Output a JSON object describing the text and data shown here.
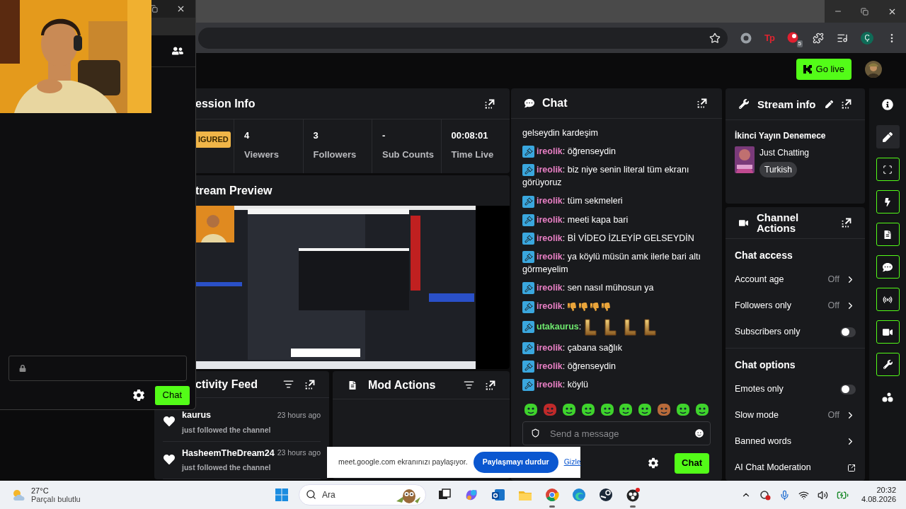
{
  "browser": {
    "window_controls": [
      {
        "kind": "minimize"
      },
      {
        "kind": "maximize"
      },
      {
        "kind": "close"
      }
    ],
    "toolbar": [
      {
        "kind": "star"
      },
      {
        "kind": "circle-extension"
      },
      {
        "kind": "text-extension",
        "label": "Tp"
      },
      {
        "kind": "badge-extension",
        "badge": "5"
      },
      {
        "kind": "puzzle"
      },
      {
        "kind": "media"
      },
      {
        "kind": "profile",
        "label": "Ç"
      },
      {
        "kind": "menu"
      }
    ]
  },
  "header": {
    "go_live": "Go live"
  },
  "session_info": {
    "title": "ession Info",
    "status": "IGURED",
    "stats": [
      {
        "value": "4",
        "label": "Viewers"
      },
      {
        "value": "3",
        "label": "Followers"
      },
      {
        "value": "-",
        "label": "Sub Counts"
      },
      {
        "value": "00:08:01",
        "label": "Time Live"
      }
    ]
  },
  "stream_preview": {
    "title": "tream Preview"
  },
  "activity_feed": {
    "title": "ctivity Feed",
    "items": [
      {
        "name": "kaurus",
        "time": "23 hours ago",
        "text": "just followed the channel"
      },
      {
        "name": "HasheemTheDream24",
        "time": "23 hours ago",
        "text": "just followed the channel"
      }
    ]
  },
  "mod_actions": {
    "title": "Mod Actions"
  },
  "chat": {
    "title": "Chat",
    "messages": [
      {
        "kind": "continuation",
        "text": "gelseydin kardeşim"
      },
      {
        "kind": "text",
        "user": "ireolik",
        "color": "#e87fc4",
        "text": ": öğrenseydin"
      },
      {
        "kind": "text",
        "user": "ireolik",
        "color": "#e87fc4",
        "text": ": biz niye senin literal tüm ekranı görüyoruz"
      },
      {
        "kind": "text",
        "user": "ireolik",
        "color": "#e87fc4",
        "text": ": tüm sekmeleri"
      },
      {
        "kind": "text",
        "user": "ireolik",
        "color": "#e87fc4",
        "text": ": meeti kapa bari"
      },
      {
        "kind": "text",
        "user": "ireolik",
        "color": "#e87fc4",
        "text": ": Bİ VİDEO İZLEYİP GELSEYDİN"
      },
      {
        "kind": "text",
        "user": "ireolik",
        "color": "#e87fc4",
        "text": ": ya köylü müsün amk ilerle bari altı görmeyelim"
      },
      {
        "kind": "text",
        "user": "ireolik",
        "color": "#e87fc4",
        "text": ": sen nasıl mühosun ya"
      },
      {
        "kind": "emotes",
        "user": "ireolik",
        "color": "#e87fc4",
        "text": ":",
        "emotes": [
          {
            "kind": "thumbs-down"
          },
          {
            "kind": "thumbs-down"
          },
          {
            "kind": "thumbs-down"
          },
          {
            "kind": "thumbs-down"
          }
        ]
      },
      {
        "kind": "emotes",
        "user": "utakaurus",
        "color": "#6ee86e",
        "text": ":",
        "emotes": [
          {
            "kind": "gold-l"
          },
          {
            "kind": "gold-l"
          },
          {
            "kind": "gold-l"
          },
          {
            "kind": "gold-l"
          }
        ]
      },
      {
        "kind": "text",
        "user": "ireolik",
        "color": "#e87fc4",
        "text": ": çabana sağlık"
      },
      {
        "kind": "text",
        "user": "ireolik",
        "color": "#e87fc4",
        "text": ": öğrenseydin"
      },
      {
        "kind": "text",
        "user": "ireolik",
        "color": "#e87fc4",
        "text": ": köylü"
      }
    ],
    "emote_bar": [
      {
        "kind": "green"
      },
      {
        "kind": "red"
      },
      {
        "kind": "green"
      },
      {
        "kind": "green"
      },
      {
        "kind": "green"
      },
      {
        "kind": "green"
      },
      {
        "kind": "green"
      },
      {
        "kind": "brown"
      },
      {
        "kind": "green"
      },
      {
        "kind": "green"
      }
    ],
    "input": {
      "placeholder": "Send a message"
    },
    "send": "Chat"
  },
  "stream_info": {
    "title": "Stream info",
    "stream_title": "İkinci Yayın Denemece",
    "category": "Just Chatting",
    "tags": [
      "Turkish"
    ]
  },
  "channel_actions": {
    "title": "Channel Actions",
    "sections": [
      {
        "heading": "Chat access",
        "rows": [
          {
            "kind": "value",
            "label": "Account age",
            "value": "Off"
          },
          {
            "kind": "value",
            "label": "Followers only",
            "value": "Off"
          },
          {
            "kind": "toggle",
            "label": "Subscribers only",
            "on": false
          }
        ]
      },
      {
        "heading": "Chat options",
        "rows": [
          {
            "kind": "toggle",
            "label": "Emotes only",
            "on": false
          },
          {
            "kind": "value",
            "label": "Slow mode",
            "value": "Off"
          },
          {
            "kind": "link",
            "label": "Banned words"
          },
          {
            "kind": "external",
            "label": "AI Chat Moderation"
          }
        ]
      }
    ]
  },
  "rail": [
    {
      "kind": "info",
      "selected": false,
      "bordered": false
    },
    {
      "kind": "pencil",
      "selected": true,
      "bordered": false
    },
    {
      "kind": "scan",
      "selected": false,
      "bordered": true
    },
    {
      "kind": "bolt",
      "selected": false,
      "bordered": true
    },
    {
      "kind": "note",
      "selected": false,
      "bordered": true
    },
    {
      "kind": "chat",
      "selected": false,
      "bordered": true
    },
    {
      "kind": "broadcast",
      "selected": false,
      "bordered": true
    },
    {
      "kind": "camera",
      "selected": false,
      "bordered": true
    },
    {
      "kind": "wrench",
      "selected": false,
      "bordered": true
    },
    {
      "kind": "share",
      "selected": false,
      "bordered": false
    }
  ],
  "popup": {
    "send": "Chat"
  },
  "share_bar": {
    "text": "meet.google.com ekranınızı paylaşıyor.",
    "stop": "Paylaşmayı durdur",
    "hide": "Gizle"
  },
  "taskbar": {
    "weather": {
      "temp": "27°C",
      "condition": "Parçalı bulutlu"
    },
    "search": {
      "placeholder": "Ara"
    },
    "apps": [
      {
        "kind": "taskview",
        "running": false
      },
      {
        "kind": "copilot",
        "running": false
      },
      {
        "kind": "outlook",
        "running": false
      },
      {
        "kind": "explorer",
        "running": false
      },
      {
        "kind": "chrome",
        "running": true
      },
      {
        "kind": "edge",
        "running": false
      },
      {
        "kind": "steam",
        "running": false
      },
      {
        "kind": "obs",
        "running": true
      }
    ],
    "time": "20:32",
    "date": "4.08.2026"
  }
}
